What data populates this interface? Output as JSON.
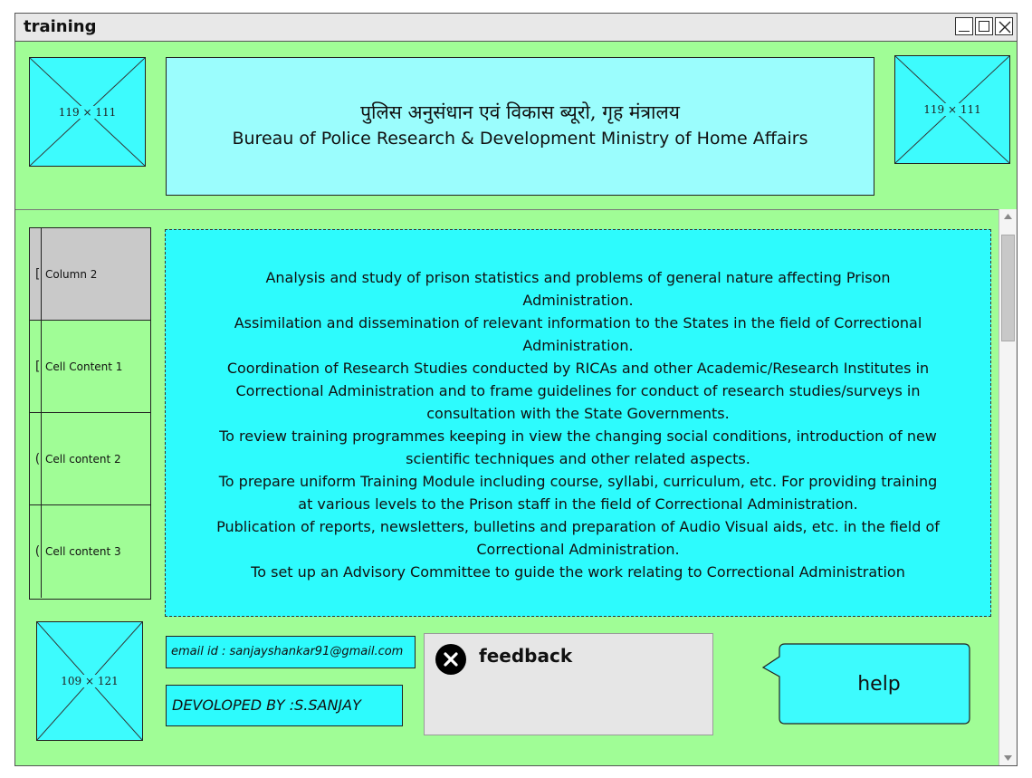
{
  "window": {
    "title": "training",
    "controls": [
      "minimize-icon",
      "maximize-icon",
      "close-icon"
    ]
  },
  "header": {
    "left_image": {
      "label": "119 × 111"
    },
    "right_image": {
      "label": "119 × 111"
    },
    "banner": {
      "hindi": "पुलिस अनुसंधान एवं विकास ब्यूरो, गृह मंत्रालय",
      "english": "Bureau of Police Research & Development Ministry of Home Affairs"
    }
  },
  "table": {
    "header": {
      "mark": "[",
      "label": "Column 2"
    },
    "rows": [
      {
        "mark": "[",
        "label": "Cell Content 1"
      },
      {
        "mark": "(",
        "label": "Cell content 2"
      },
      {
        "mark": "(",
        "label": "Cell content 3"
      }
    ]
  },
  "content": {
    "items": [
      "Analysis and study of prison statistics and problems of general nature affecting Prison Administration.",
      "Assimilation and dissemination of relevant information to the States in the field of Correctional Administration.",
      "Coordination of Research Studies conducted by RICAs and other Academic/Research Institutes in Correctional Administration and to frame guidelines for conduct of research studies/surveys in consultation with the State Governments.",
      "To review training programmes keeping in view the changing social conditions, introduction of new scientific techniques and other related aspects.",
      "To prepare uniform Training Module including course, syllabi, curriculum, etc. For providing training at various levels to the Prison staff in the field of Correctional Administration.",
      "Publication of reports, newsletters, bulletins and preparation of Audio Visual aids, etc. in the field of Correctional Administration.",
      "To set up an Advisory Committee to guide the work relating to Correctional Administration"
    ]
  },
  "footer": {
    "image": {
      "label": "109 × 121"
    },
    "email": "email id : sanjayshankar91@gmail.com",
    "developer": "DEVOLOPED BY :S.SANJAY",
    "feedback": {
      "label": "feedback",
      "icon": "close-circle-icon"
    },
    "help": {
      "label": "help"
    }
  },
  "colors": {
    "background": "#a0fd96",
    "panel": "#2dfbfd",
    "banner": "#9bfdfd"
  }
}
